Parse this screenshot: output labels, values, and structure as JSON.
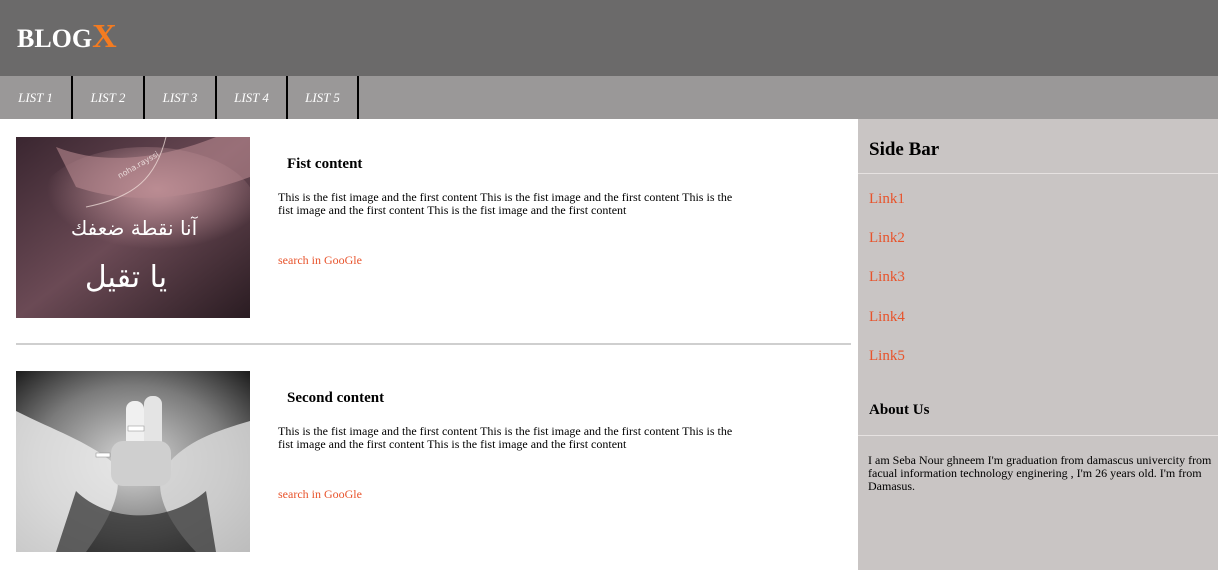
{
  "header": {
    "logo_text": "BLOG",
    "logo_accent": "X",
    "accent_color": "#f47b20"
  },
  "nav": {
    "items": [
      "LIST 1",
      "LIST 2",
      "LIST 3",
      "LIST 4",
      "LIST 5"
    ]
  },
  "posts": [
    {
      "title": "Fist content",
      "image_icon": "photo-icon",
      "image_text": "آنا نقطة ضعفك يا تقيل",
      "image_watermark": "noha.rayssi",
      "body": "This is the fist image and the first content This is the fist image and the first content This is the fist image and the first content This is the fist image and the first content",
      "link": "search in GooGle"
    },
    {
      "title": "Second content",
      "image_icon": "photo-icon",
      "body": "This is the fist image and the first content This is the fist image and the first content This is the fist image and the first content This is the fist image and the first content",
      "link": "search in GooGle"
    }
  ],
  "sidebar": {
    "title": "Side Bar",
    "links": [
      "Link1",
      "Link2",
      "Link3",
      "Link4",
      "Link5"
    ],
    "about_title": "About Us",
    "about_text": "I am Seba Nour ghneem I'm graduation from damascus univercity from facual information technology enginering , I'm 26 years old. I'm from Damasus."
  },
  "colors": {
    "header_bg": "#6b6a6a",
    "nav_bg": "#9a9898",
    "sidebar_bg": "#c9c5c4",
    "link": "#e8532b"
  }
}
